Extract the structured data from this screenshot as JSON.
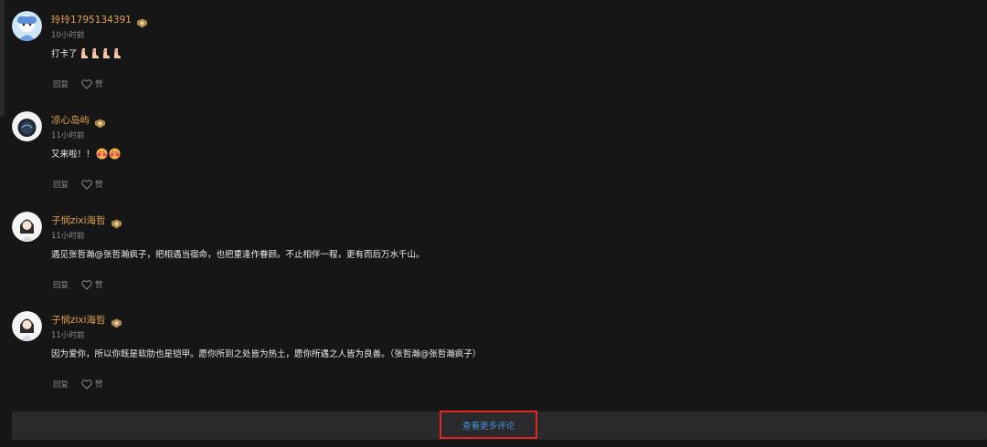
{
  "comments": [
    {
      "username": "玲玲1795134391",
      "time": "10小时前",
      "text": "打卡了",
      "emoji": "foot",
      "emoji_count": 4,
      "avatar": "blue-character-avatar",
      "reply_label": "回复",
      "like_label": "赞"
    },
    {
      "username": "凉心岛屿",
      "time": "11小时前",
      "text": "又来啦！！",
      "emoji": "blush-face",
      "emoji_count": 2,
      "avatar": "dark-circle-avatar",
      "reply_label": "回复",
      "like_label": "赞"
    },
    {
      "username": "子悯zixi海哲",
      "time": "11小时前",
      "text": "遇见张哲瀚@张哲瀚疯子，把相遇当宿命，也把重逢作眷顾。不止相伴一程，更有而后万水千山。",
      "avatar": "anime-girl-avatar",
      "reply_label": "回复",
      "like_label": "赞"
    },
    {
      "username": "子悯zixi海哲",
      "time": "11小时前",
      "text": "因为爱你，所以你既是软肋也是铠甲。愿你所到之处皆为热土，愿你所遇之人皆为良善。（张哲瀚@张哲瀚疯子）",
      "avatar": "anime-girl-avatar",
      "reply_label": "回复",
      "like_label": "赞"
    }
  ],
  "more_button": {
    "label": "查看更多评论"
  },
  "colors": {
    "background": "#161617",
    "username": "#e3a24e",
    "link": "#4a90e2",
    "highlight_border": "#e0261d"
  }
}
